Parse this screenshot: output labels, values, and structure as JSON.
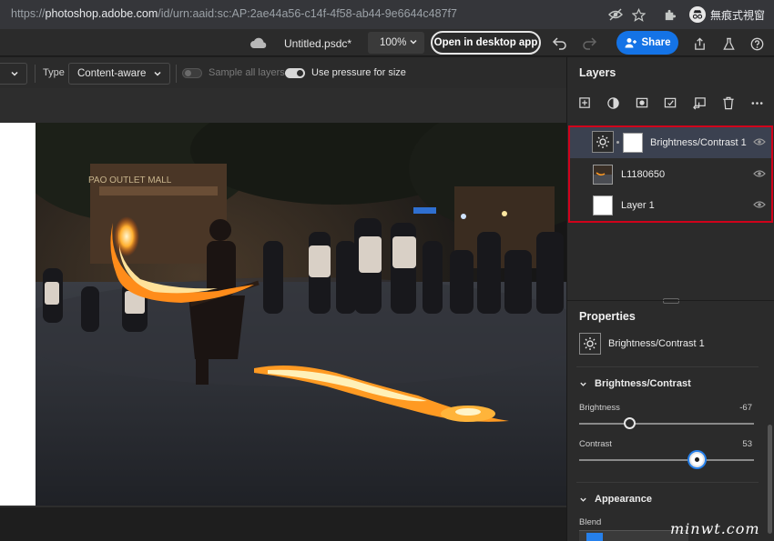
{
  "browser": {
    "url_scheme": "https://",
    "url_host": "photoshop.adobe.com",
    "url_path": "/id/urn:aaid:sc:AP:2ae44a56-c14f-4f58-ab44-9e6644c487f7",
    "profile_label": "無痕式視窗"
  },
  "header": {
    "doc_name": "Untitled.psdc*",
    "zoom": "100%",
    "open_desktop_label": "Open in desktop app",
    "share_label": "Share"
  },
  "options": {
    "type_label": "Type",
    "type_value": "Content-aware",
    "sample_all_layers": "Sample all layers",
    "sample_all_layers_on": false,
    "use_pressure": "Use pressure for size",
    "use_pressure_on": true
  },
  "layers_panel": {
    "title": "Layers",
    "layers": [
      {
        "name": "Brightness/Contrast 1",
        "selected": true
      },
      {
        "name": "L1180650",
        "selected": false
      },
      {
        "name": "Layer 1",
        "selected": false
      }
    ]
  },
  "properties": {
    "title": "Properties",
    "layer_name": "Brightness/Contrast 1",
    "section_title": "Brightness/Contrast",
    "brightness_label": "Brightness",
    "brightness_value": "-67",
    "brightness_fraction": 0.29,
    "contrast_label": "Contrast",
    "contrast_value": "53",
    "contrast_fraction": 0.676,
    "appearance_title": "Appearance",
    "blend_label": "Blend"
  },
  "photo": {
    "sign_text": "PAO OUTLET MALL"
  },
  "watermark": "minwt.com",
  "colors": {
    "accent": "#1473e6",
    "highlight_border": "#d0021b",
    "panel_bg": "#2b2b2b"
  }
}
